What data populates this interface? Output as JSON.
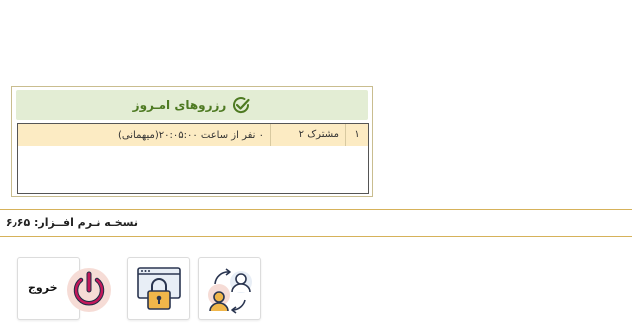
{
  "reservations": {
    "title": "رزروهای امـروز",
    "rows": [
      {
        "number": "۱",
        "name": "مشترک ۲",
        "description": "۰ نفر از ساعت ۲۰:۰۵:۰۰(میهمانی)"
      }
    ]
  },
  "footer": {
    "version_label": "نسخـه نـرم افــزار: ۶٫۶۵"
  },
  "tiles": [
    {
      "icon": "user-switch-icon"
    },
    {
      "icon": "lock-screen-icon"
    },
    {
      "icon": "power-icon",
      "label": "خروج"
    }
  ],
  "colors": {
    "header_bg": "#e3edd4",
    "header_text": "#4e7a22",
    "row_highlight": "#fcebc3",
    "divider": "#d6b25a"
  }
}
